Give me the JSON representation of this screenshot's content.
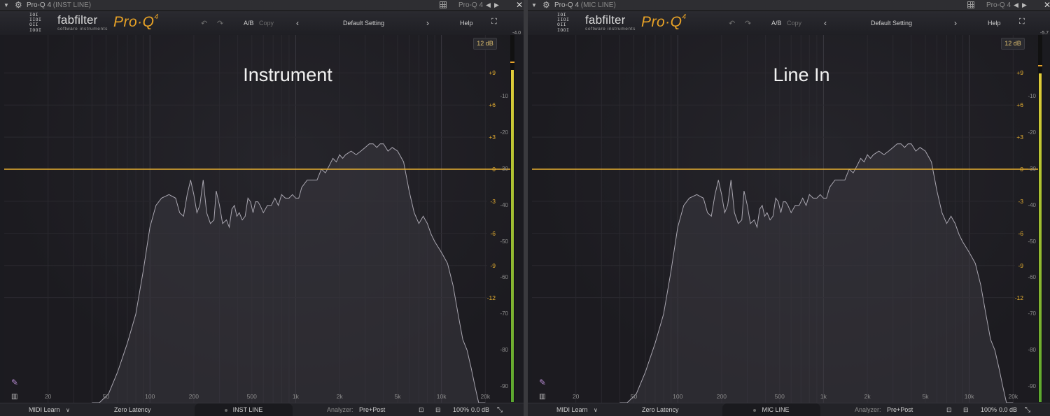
{
  "windows": [
    {
      "host_title": "Pro-Q 4",
      "host_track": "(INST LINE)",
      "host_preset": "Pro-Q 4",
      "logo": {
        "bits": "IOI\nIIOI\nOII\nIOOI",
        "brand": "fabfilter",
        "sub": "software instruments",
        "product": "Pro·Q",
        "product_version": "4"
      },
      "toolbar": {
        "ab": "A/B",
        "copy": "Copy",
        "preset": "Default Setting",
        "help": "Help"
      },
      "range_button": "12 dB",
      "peak_readout": "-4.0",
      "overlay_label": "Instrument",
      "meter_level": 0.905,
      "bottom": {
        "midi_learn": "MIDI Learn",
        "latency": "Zero Latency",
        "instance": "INST LINE",
        "analyzer_label": "Analyzer:",
        "analyzer_value": "Pre+Post",
        "zoom": "100%",
        "output_gain": "0.0 dB"
      }
    },
    {
      "host_title": "Pro-Q 4",
      "host_track": "(MIC LINE)",
      "host_preset": "Pro-Q 4",
      "logo": {
        "bits": "IOI\nIIOI\nOII\nIOOI",
        "brand": "fabfilter",
        "sub": "software instruments",
        "product": "Pro·Q",
        "product_version": "4"
      },
      "toolbar": {
        "ab": "A/B",
        "copy": "Copy",
        "preset": "Default Setting",
        "help": "Help"
      },
      "range_button": "12 dB",
      "peak_readout": "-5.7",
      "overlay_label": "Line In",
      "meter_level": 0.895,
      "bottom": {
        "midi_learn": "MIDI Learn",
        "latency": "Zero Latency",
        "instance": "MIC LINE",
        "analyzer_label": "Analyzer:",
        "analyzer_value": "Pre+Post",
        "zoom": "100%",
        "output_gain": "0.0 dB"
      }
    }
  ],
  "eq_scale": [
    "+9",
    "+6",
    "+3",
    "0",
    "-3",
    "-6",
    "-9",
    "-12"
  ],
  "analyzer_scale": [
    "-10",
    "-20",
    "-30",
    "-40",
    "-50",
    "-60",
    "-70",
    "-80",
    "-90"
  ],
  "freq_scale": [
    "20",
    "50",
    "100",
    "200",
    "500",
    "1k",
    "2k",
    "5k",
    "10k",
    "20k"
  ],
  "spectra": [
    [
      [
        40,
        -110
      ],
      [
        45,
        -102
      ],
      [
        52,
        -92
      ],
      [
        60,
        -86
      ],
      [
        70,
        -78
      ],
      [
        80,
        -70
      ],
      [
        90,
        -58
      ],
      [
        100,
        -46
      ],
      [
        110,
        -40
      ],
      [
        120,
        -38
      ],
      [
        135,
        -37
      ],
      [
        150,
        -38
      ],
      [
        160,
        -42
      ],
      [
        170,
        -43
      ],
      [
        180,
        -37
      ],
      [
        190,
        -33
      ],
      [
        200,
        -37
      ],
      [
        210,
        -42
      ],
      [
        220,
        -40
      ],
      [
        232,
        -33
      ],
      [
        245,
        -42
      ],
      [
        260,
        -45
      ],
      [
        275,
        -44
      ],
      [
        285,
        -36
      ],
      [
        300,
        -40
      ],
      [
        315,
        -45
      ],
      [
        335,
        -44
      ],
      [
        350,
        -46
      ],
      [
        365,
        -41
      ],
      [
        380,
        -40
      ],
      [
        395,
        -43
      ],
      [
        410,
        -42
      ],
      [
        430,
        -44
      ],
      [
        450,
        -43
      ],
      [
        470,
        -38
      ],
      [
        490,
        -39
      ],
      [
        510,
        -42
      ],
      [
        530,
        -39
      ],
      [
        550,
        -39
      ],
      [
        570,
        -40
      ],
      [
        600,
        -42
      ],
      [
        640,
        -40
      ],
      [
        680,
        -40
      ],
      [
        720,
        -38
      ],
      [
        760,
        -40
      ],
      [
        800,
        -37
      ],
      [
        850,
        -38
      ],
      [
        900,
        -38
      ],
      [
        950,
        -37
      ],
      [
        1000,
        -38
      ],
      [
        1050,
        -38
      ],
      [
        1100,
        -35
      ],
      [
        1200,
        -33
      ],
      [
        1300,
        -33
      ],
      [
        1400,
        -33
      ],
      [
        1500,
        -30
      ],
      [
        1600,
        -31
      ],
      [
        1700,
        -29
      ],
      [
        1800,
        -27
      ],
      [
        1900,
        -28
      ],
      [
        2000,
        -26
      ],
      [
        2100,
        -27
      ],
      [
        2200,
        -26
      ],
      [
        2400,
        -25
      ],
      [
        2600,
        -26
      ],
      [
        2800,
        -25
      ],
      [
        3000,
        -24
      ],
      [
        3200,
        -23
      ],
      [
        3400,
        -23
      ],
      [
        3600,
        -24
      ],
      [
        3800,
        -23
      ],
      [
        4000,
        -23
      ],
      [
        4300,
        -25
      ],
      [
        4600,
        -24
      ],
      [
        5000,
        -25
      ],
      [
        5500,
        -28
      ],
      [
        6000,
        -36
      ],
      [
        6500,
        -42
      ],
      [
        7000,
        -45
      ],
      [
        7500,
        -43
      ],
      [
        8000,
        -45
      ],
      [
        8500,
        -48
      ],
      [
        9000,
        -50
      ],
      [
        10000,
        -53
      ],
      [
        11000,
        -56
      ],
      [
        12000,
        -62
      ],
      [
        13000,
        -70
      ],
      [
        14000,
        -77
      ],
      [
        15000,
        -80
      ],
      [
        16000,
        -85
      ],
      [
        17000,
        -90
      ],
      [
        18000,
        -98
      ],
      [
        19000,
        -106
      ],
      [
        20000,
        -112
      ]
    ],
    [
      [
        40,
        -110
      ],
      [
        45,
        -102
      ],
      [
        52,
        -92
      ],
      [
        60,
        -86
      ],
      [
        70,
        -78
      ],
      [
        80,
        -70
      ],
      [
        90,
        -58
      ],
      [
        100,
        -46
      ],
      [
        110,
        -40
      ],
      [
        120,
        -38
      ],
      [
        135,
        -37
      ],
      [
        150,
        -38
      ],
      [
        160,
        -42
      ],
      [
        170,
        -43
      ],
      [
        180,
        -37
      ],
      [
        190,
        -33
      ],
      [
        200,
        -37
      ],
      [
        210,
        -42
      ],
      [
        220,
        -40
      ],
      [
        232,
        -33
      ],
      [
        245,
        -42
      ],
      [
        260,
        -45
      ],
      [
        275,
        -44
      ],
      [
        285,
        -36
      ],
      [
        300,
        -40
      ],
      [
        315,
        -45
      ],
      [
        335,
        -44
      ],
      [
        350,
        -46
      ],
      [
        365,
        -41
      ],
      [
        380,
        -40
      ],
      [
        395,
        -43
      ],
      [
        410,
        -42
      ],
      [
        430,
        -44
      ],
      [
        450,
        -43
      ],
      [
        470,
        -38
      ],
      [
        490,
        -39
      ],
      [
        510,
        -42
      ],
      [
        530,
        -39
      ],
      [
        550,
        -39
      ],
      [
        570,
        -40
      ],
      [
        600,
        -42
      ],
      [
        640,
        -40
      ],
      [
        680,
        -40
      ],
      [
        720,
        -38
      ],
      [
        760,
        -40
      ],
      [
        800,
        -37
      ],
      [
        850,
        -38
      ],
      [
        900,
        -38
      ],
      [
        950,
        -37
      ],
      [
        1000,
        -38
      ],
      [
        1050,
        -38
      ],
      [
        1100,
        -35
      ],
      [
        1200,
        -33
      ],
      [
        1300,
        -33
      ],
      [
        1400,
        -33
      ],
      [
        1500,
        -30
      ],
      [
        1600,
        -31
      ],
      [
        1700,
        -29
      ],
      [
        1800,
        -27
      ],
      [
        1900,
        -28
      ],
      [
        2000,
        -26
      ],
      [
        2100,
        -27
      ],
      [
        2200,
        -26
      ],
      [
        2400,
        -25
      ],
      [
        2600,
        -26
      ],
      [
        2800,
        -25
      ],
      [
        3000,
        -24
      ],
      [
        3200,
        -23
      ],
      [
        3400,
        -23
      ],
      [
        3600,
        -24
      ],
      [
        3800,
        -23
      ],
      [
        4000,
        -23
      ],
      [
        4300,
        -25
      ],
      [
        4600,
        -24
      ],
      [
        5000,
        -25
      ],
      [
        5500,
        -28
      ],
      [
        6000,
        -36
      ],
      [
        6500,
        -42
      ],
      [
        7000,
        -45
      ],
      [
        7500,
        -43
      ],
      [
        8000,
        -45
      ],
      [
        8500,
        -48
      ],
      [
        9000,
        -50
      ],
      [
        10000,
        -53
      ],
      [
        11000,
        -56
      ],
      [
        12000,
        -62
      ],
      [
        13000,
        -70
      ],
      [
        14000,
        -77
      ],
      [
        15000,
        -80
      ],
      [
        16000,
        -85
      ],
      [
        17000,
        -90
      ],
      [
        18000,
        -98
      ],
      [
        19000,
        -106
      ],
      [
        20000,
        -112
      ]
    ]
  ],
  "colors": {
    "eq_line": "#e8b030",
    "spectrum": "#a9a6b0",
    "spectrum_fill": "#3a3840",
    "db_text": "#e8b030",
    "meter_peak": "#e6a22a"
  },
  "icons": {
    "collapse": "triangle-down-icon",
    "settings": "gear-icon",
    "close": "close-icon",
    "undo": "undo-icon",
    "redo": "redo-icon",
    "fullscreen": "fullscreen-icon",
    "paint": "pencil-icon",
    "piano": "piano-icon",
    "resize": "resize-icon"
  }
}
